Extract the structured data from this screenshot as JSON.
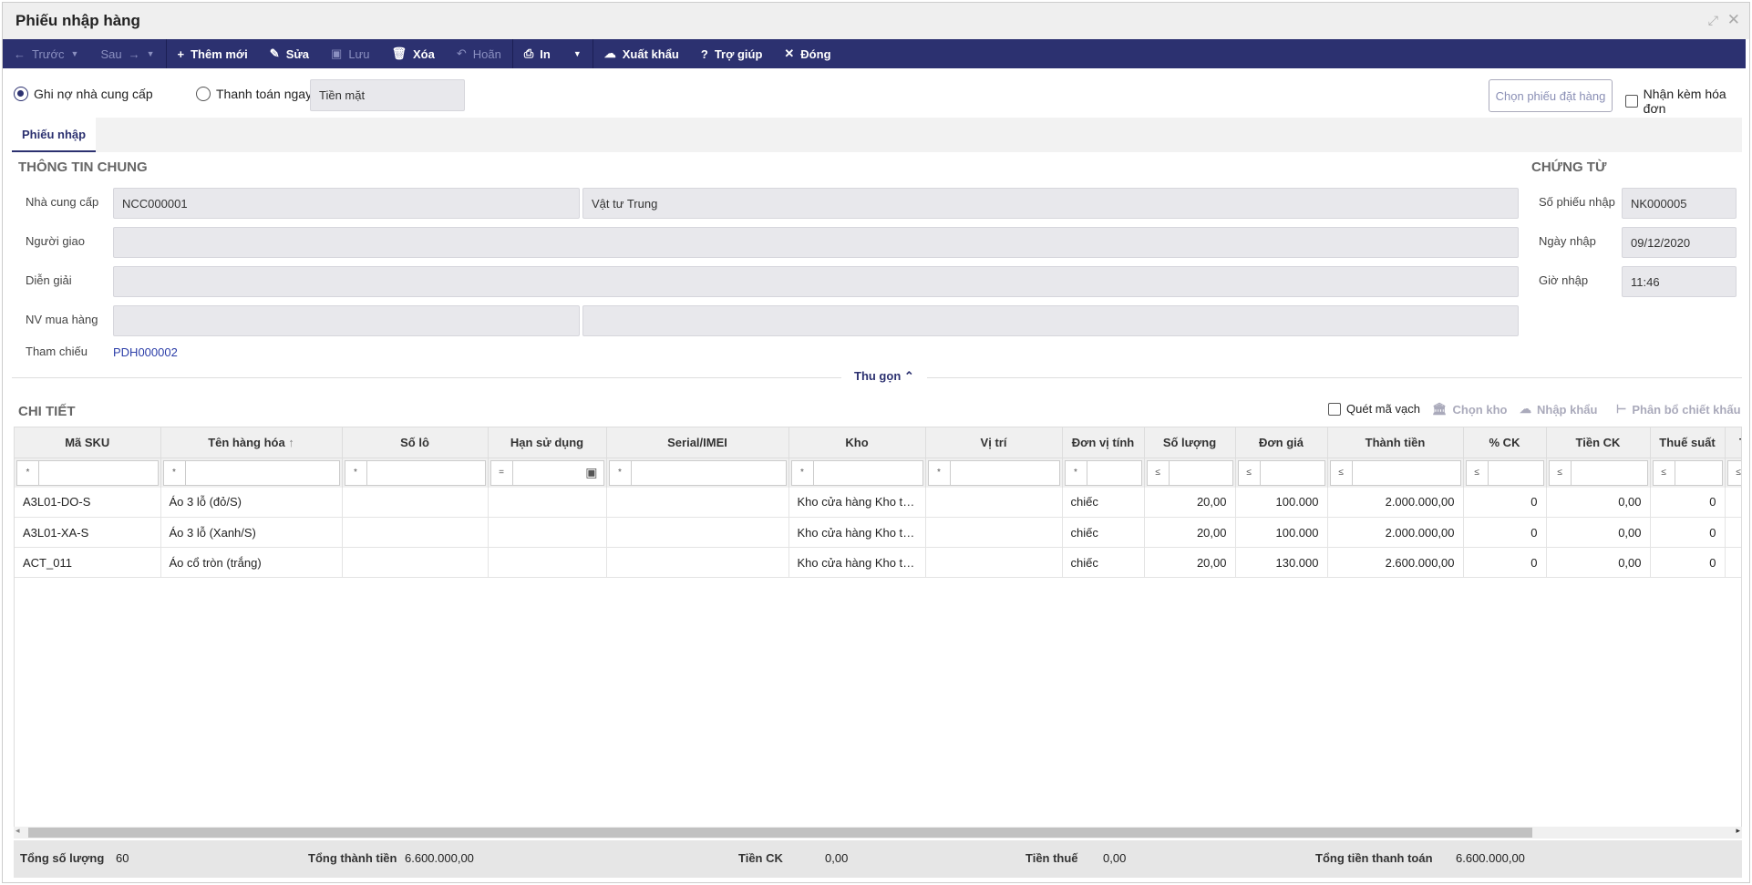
{
  "window": {
    "title": "Phiếu nhập hàng"
  },
  "toolbar": {
    "prev": "Trước",
    "next": "Sau",
    "add": "Thêm mới",
    "edit": "Sửa",
    "save": "Lưu",
    "delete": "Xóa",
    "undo": "Hoãn",
    "print": "In",
    "export": "Xuất khẩu",
    "help": "Trợ giúp",
    "close": "Đóng"
  },
  "payment": {
    "debt_label": "Ghi nợ nhà cung cấp",
    "pay_now_label": "Thanh toán ngay",
    "method": "Tiền mặt",
    "choose_order": "Chọn phiếu đặt hàng",
    "with_invoice": "Nhận kèm hóa đơn"
  },
  "tabs": [
    "Phiếu nhập"
  ],
  "general": {
    "title": "THÔNG TIN CHUNG",
    "supplier_label": "Nhà cung cấp",
    "supplier_code": "NCC000001",
    "supplier_name": "Vật tư Trung",
    "deliverer_label": "Người giao",
    "deliverer": "",
    "note_label": "Diễn giải",
    "note": "",
    "buyer_label": "NV mua hàng",
    "reference_label": "Tham chiếu",
    "reference": "PDH000002"
  },
  "voucher": {
    "title": "CHỨNG TỪ",
    "number_label": "Số phiếu nhập",
    "number": "NK000005",
    "date_label": "Ngày nhập",
    "date": "09/12/2020",
    "time_label": "Giờ nhập",
    "time": "11:46"
  },
  "collapse_label": "Thu gọn",
  "detail": {
    "title": "CHI TIẾT",
    "scan": "Quét mã vạch",
    "choose_store": "Chọn kho",
    "import": "Nhập khẩu",
    "allocate": "Phân bổ chiết khấu"
  },
  "columns": [
    "Mã SKU",
    "Tên hàng hóa",
    "Số lô",
    "Hạn sử dụng",
    "Serial/IMEI",
    "Kho",
    "Vị trí",
    "Đơn vị tính",
    "Số lượng",
    "Đơn giá",
    "Thành tiền",
    "% CK",
    "Tiền CK",
    "Thuế suất",
    "T"
  ],
  "filter_ops": [
    "*",
    "*",
    "*",
    "=",
    "*",
    "*",
    "*",
    "*",
    "≤",
    "≤",
    "≤",
    "≤",
    "≤",
    "≤",
    "≤"
  ],
  "rows": [
    [
      "A3L01-DO-S",
      "Áo 3 lỗ (đỏ/S)",
      "",
      "",
      "",
      "Kho cửa hàng Kho tổng",
      "",
      "chiếc",
      "20,00",
      "100.000",
      "2.000.000,00",
      "0",
      "0,00",
      "0",
      ""
    ],
    [
      "A3L01-XA-S",
      "Áo 3 lỗ (Xanh/S)",
      "",
      "",
      "",
      "Kho cửa hàng Kho tổng",
      "",
      "chiếc",
      "20,00",
      "100.000",
      "2.000.000,00",
      "0",
      "0,00",
      "0",
      ""
    ],
    [
      "ACT_011",
      "Áo cổ tròn (trắng)",
      "",
      "",
      "",
      "Kho cửa hàng Kho tổng",
      "",
      "chiếc",
      "20,00",
      "130.000",
      "2.600.000,00",
      "0",
      "0,00",
      "0",
      ""
    ]
  ],
  "footer": {
    "qty_label": "Tổng số lượng",
    "qty": "60",
    "amount_label": "Tổng thành tiền",
    "amount": "6.600.000,00",
    "discount_label": "Tiền CK",
    "discount": "0,00",
    "tax_label": "Tiền thuế",
    "tax": "0,00",
    "total_label": "Tổng tiền thanh toán",
    "total": "6.600.000,00"
  }
}
